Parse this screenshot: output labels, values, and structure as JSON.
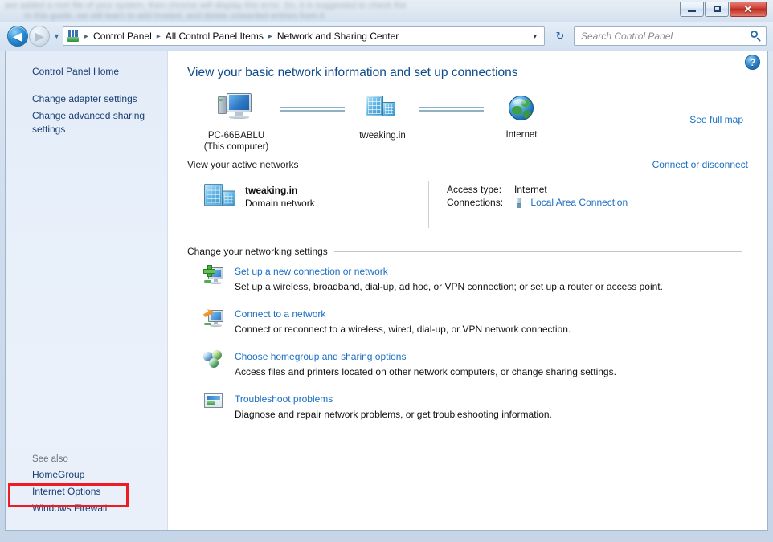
{
  "window": {
    "ghost_text_1": "are added a root file of your system, then chrome will display this error. So, it is suggested to check the",
    "ghost_text_2": "In this guide, we will learn to add trusted, and delete unwanted entries from it",
    "minimize_label": "Minimize",
    "maximize_label": "Maximize",
    "close_label": "Close"
  },
  "addressbar": {
    "back_label": "Back",
    "back_glyph": "◀",
    "forward_label": "Forward",
    "forward_glyph": "▶",
    "history_glyph": "▼",
    "crumbs": [
      "Control Panel",
      "All Control Panel Items",
      "Network and Sharing Center"
    ],
    "separator": "▸",
    "dropdown_glyph": "▾",
    "refresh_glyph": "↻",
    "search_placeholder": "Search Control Panel",
    "search_value": ""
  },
  "sidebar": {
    "items": [
      {
        "label": "Control Panel Home"
      },
      {
        "label": "Change adapter settings"
      },
      {
        "label": "Change advanced sharing settings"
      }
    ],
    "see_also_label": "See also",
    "see_also_items": [
      {
        "label": "HomeGroup"
      },
      {
        "label": "Internet Options",
        "highlighted": true
      },
      {
        "label": "Windows Firewall"
      }
    ],
    "highlight_color": "#ed1c24"
  },
  "content": {
    "help_label": "?",
    "page_title": "View your basic network information and set up connections",
    "see_full_map": "See full map",
    "netmap": {
      "nodes": [
        {
          "name": "PC-66BABLU",
          "sub": "(This computer)",
          "icon": "computer-icon"
        },
        {
          "name": "tweaking.in",
          "sub": "",
          "icon": "server-icon"
        },
        {
          "name": "Internet",
          "sub": "",
          "icon": "globe-icon"
        }
      ]
    },
    "active_networks": {
      "heading": "View your active networks",
      "action": "Connect or disconnect",
      "network_name": "tweaking.in",
      "network_type": "Domain network",
      "details": [
        {
          "key": "Access type:",
          "value": "Internet",
          "is_link": false
        },
        {
          "key": "Connections:",
          "value": "Local Area Connection",
          "is_link": true
        }
      ]
    },
    "settings": {
      "heading": "Change your networking settings",
      "items": [
        {
          "icon": "new-connection-icon",
          "title": "Set up a new connection or network",
          "desc": "Set up a wireless, broadband, dial-up, ad hoc, or VPN connection; or set up a router or access point."
        },
        {
          "icon": "connect-network-icon",
          "title": "Connect to a network",
          "desc": "Connect or reconnect to a wireless, wired, dial-up, or VPN network connection."
        },
        {
          "icon": "homegroup-icon",
          "title": "Choose homegroup and sharing options",
          "desc": "Access files and printers located on other network computers, or change sharing settings."
        },
        {
          "icon": "troubleshoot-icon",
          "title": "Troubleshoot problems",
          "desc": "Diagnose and repair network problems, or get troubleshooting information."
        }
      ]
    }
  },
  "colors": {
    "link": "#1a6fc4",
    "title": "#0f4a8a",
    "sidebar_link": "#1b3f73",
    "annotation": "#ed1c24"
  }
}
